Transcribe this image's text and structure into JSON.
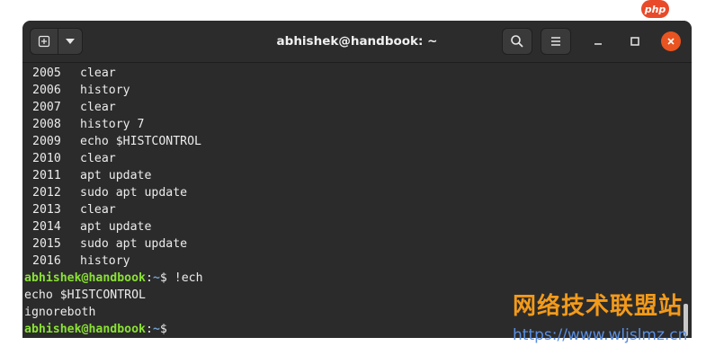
{
  "badge": {
    "text": "php"
  },
  "window": {
    "title": "abhishek@handbook: ~",
    "icons": {
      "new_tab": "new-tab-icon",
      "dropdown": "chevron-down-icon",
      "search": "search-icon",
      "menu": "hamburger-menu-icon",
      "minimize": "minimize-icon",
      "maximize": "maximize-icon",
      "close": "close-icon"
    },
    "colors": {
      "close_accent": "#e95420",
      "user_host": "#8ae234",
      "path": "#729fcf"
    }
  },
  "terminal": {
    "history": [
      {
        "num": "2005",
        "cmd": "clear"
      },
      {
        "num": "2006",
        "cmd": "history"
      },
      {
        "num": "2007",
        "cmd": "clear"
      },
      {
        "num": "2008",
        "cmd": "history 7"
      },
      {
        "num": "2009",
        "cmd": "echo $HISTCONTROL"
      },
      {
        "num": "2010",
        "cmd": "clear"
      },
      {
        "num": "2011",
        "cmd": "apt update"
      },
      {
        "num": "2012",
        "cmd": "sudo apt update"
      },
      {
        "num": "2013",
        "cmd": "clear"
      },
      {
        "num": "2014",
        "cmd": "apt update"
      },
      {
        "num": "2015",
        "cmd": "sudo apt update"
      },
      {
        "num": "2016",
        "cmd": "history"
      }
    ],
    "prompt": {
      "user_host": "abhishek@handbook",
      "sep": ":",
      "path": "~",
      "symbol": "$ "
    },
    "command": "!ech",
    "output": [
      "echo $HISTCONTROL",
      "ignoreboth"
    ]
  },
  "watermark": {
    "cn": "网络技术联盟站",
    "url": "https://www.wljslmz.cn"
  }
}
